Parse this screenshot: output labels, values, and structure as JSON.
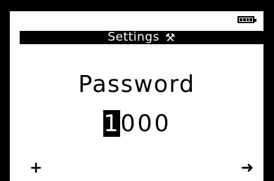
{
  "status": {
    "battery_icon": "battery-full-icon"
  },
  "header": {
    "title": "Settings",
    "icon": "tools-icon",
    "icon_glyph": "⚒"
  },
  "main": {
    "heading": "Password",
    "password_digits": [
      "1",
      "0",
      "0",
      "0"
    ],
    "active_digit_index": 0
  },
  "softkeys": {
    "left": "+",
    "right": "➜"
  },
  "colors": {
    "foreground": "#000000",
    "background": "#ffffff"
  }
}
